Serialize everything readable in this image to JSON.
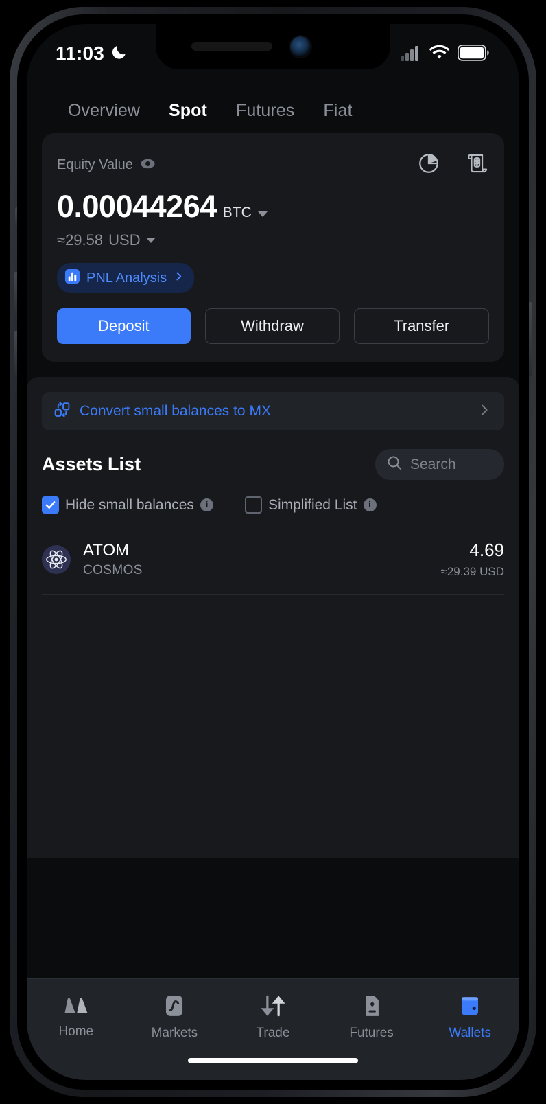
{
  "status_bar": {
    "time": "11:03",
    "dnd_icon": "crescent-moon-icon",
    "signal_icon": "cellular-signal-icon",
    "wifi_icon": "wifi-icon",
    "battery_icon": "battery-full-icon"
  },
  "top_tabs": [
    {
      "label": "Overview",
      "active": false
    },
    {
      "label": "Spot",
      "active": true
    },
    {
      "label": "Futures",
      "active": false
    },
    {
      "label": "Fiat",
      "active": false
    }
  ],
  "equity_card": {
    "label": "Equity Value",
    "eye_icon": "eye-icon",
    "pie_chart_icon": "pie-chart-icon",
    "history_icon": "transaction-history-icon",
    "amount": "0.00044264",
    "unit": "BTC",
    "approx_value": "≈29.58",
    "approx_unit": "USD",
    "pnl": {
      "label": "PNL Analysis",
      "icon": "bar-chart-icon",
      "chevron": "chevron-right-icon"
    },
    "buttons": [
      {
        "label": "Deposit",
        "style": "primary"
      },
      {
        "label": "Withdraw",
        "style": "ghost"
      },
      {
        "label": "Transfer",
        "style": "ghost"
      }
    ]
  },
  "convert_banner": {
    "icon": "convert-icon",
    "label": "Convert small balances to MX",
    "chevron": "chevron-right-icon"
  },
  "assets": {
    "title": "Assets List",
    "search_placeholder": "Search",
    "search_value": "",
    "search_icon": "search-icon",
    "filters": [
      {
        "label": "Hide small balances",
        "checked": true,
        "info_icon": "info-icon"
      },
      {
        "label": "Simplified List",
        "checked": false,
        "info_icon": "info-icon"
      }
    ],
    "rows": [
      {
        "icon": "atom-coin-icon",
        "symbol": "ATOM",
        "fullname": "COSMOS",
        "amount": "4.69",
        "usd": "≈29.39 USD"
      }
    ]
  },
  "bottom_nav": [
    {
      "label": "Home",
      "icon": "home-mountain-icon",
      "active": false
    },
    {
      "label": "Markets",
      "icon": "markets-chart-icon",
      "active": false
    },
    {
      "label": "Trade",
      "icon": "trade-arrows-icon",
      "active": false
    },
    {
      "label": "Futures",
      "icon": "futures-contract-icon",
      "active": false
    },
    {
      "label": "Wallets",
      "icon": "wallet-icon",
      "active": true
    }
  ],
  "colors": {
    "accent_blue": "#3b7bfa",
    "link_blue": "#4e8cff",
    "card_bg": "#17191d",
    "screen_bg": "#0b0c0e",
    "nav_bg": "#212429",
    "muted_text": "#8b9099"
  }
}
